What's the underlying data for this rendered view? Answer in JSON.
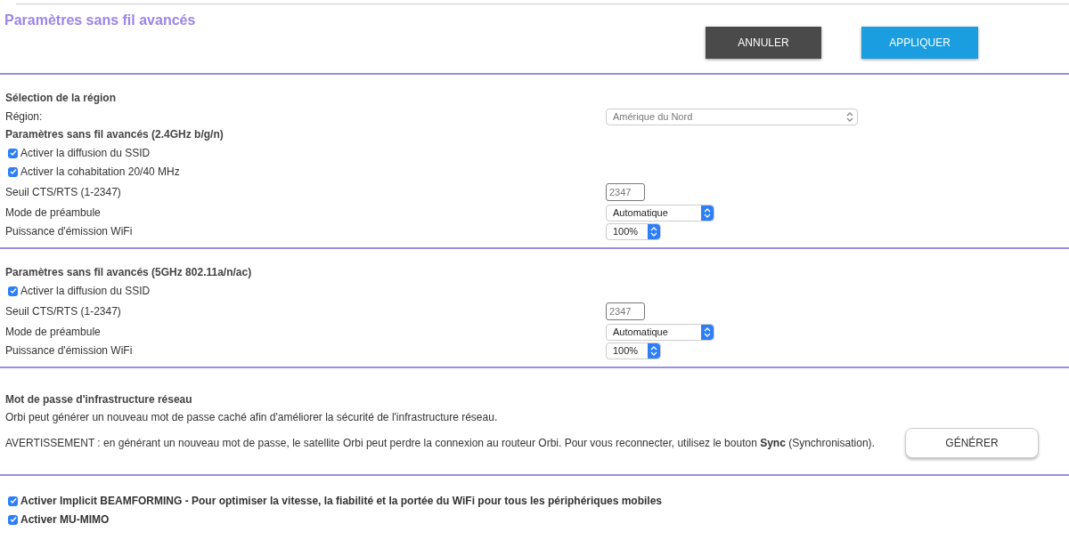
{
  "title": "Paramètres sans fil avancés",
  "buttons": [
    {
      "label": "ANNULER",
      "kind": "secondary"
    },
    {
      "label": "APPLIQUER",
      "kind": "primary"
    }
  ],
  "blocks": [
    {
      "groups": [
        {
          "heading": "Sélection de la région",
          "rows": [
            {
              "kind": "select-wide",
              "label": "Région:",
              "value": "Amérique du Nord"
            }
          ]
        },
        {
          "heading": "Paramètres sans fil avancés (2.4GHz b/g/n)",
          "rows": [
            {
              "kind": "checkbox",
              "label": "Activer la diffusion du SSID",
              "checked": true
            },
            {
              "kind": "checkbox",
              "label": "Activer la cohabitation 20/40 MHz",
              "checked": true
            },
            {
              "kind": "input",
              "label": "Seuil CTS/RTS (1-2347)",
              "value": "2347"
            },
            {
              "kind": "select",
              "label": "Mode de préambule",
              "value": "Automatique"
            },
            {
              "kind": "select-small",
              "label": "Puissance d'émission WiFi",
              "value": "100%"
            }
          ]
        }
      ]
    },
    {
      "groups": [
        {
          "heading": "Paramètres sans fil avancés (5GHz 802.11a/n/ac)",
          "rows": [
            {
              "kind": "checkbox",
              "label": "Activer la diffusion du SSID",
              "checked": true
            },
            {
              "kind": "input",
              "label": "Seuil CTS/RTS (1-2347)",
              "value": "2347"
            },
            {
              "kind": "select",
              "label": "Mode de préambule",
              "value": "Automatique"
            },
            {
              "kind": "select-small",
              "label": "Puissance d'émission WiFi",
              "value": "100%"
            }
          ]
        }
      ]
    },
    {
      "password": {
        "heading": "Mot de passe d'infrastructure réseau",
        "text": "Orbi peut générer un nouveau mot de passe caché afin d'améliorer la sécurité de l'infrastructure réseau.",
        "warning": "AVERTISSEMENT : en générant un nouveau mot de passe, le satellite Orbi peut perdre la connexion au routeur Orbi. Pour vous reconnecter, utilisez le bouton **Sync** (Synchronisation).",
        "button": "GÉNÉRER"
      }
    },
    {
      "groups": [
        {
          "rows": [
            {
              "kind": "checkbox-bold",
              "label": "Activer Implicit BEAMFORMING - Pour optimiser la vitesse, la fiabilité et la portée du WiFi pour tous les périphériques mobiles",
              "checked": true
            },
            {
              "kind": "checkbox-bold",
              "label": "Activer MU-MIMO",
              "checked": true
            }
          ]
        }
      ]
    }
  ]
}
